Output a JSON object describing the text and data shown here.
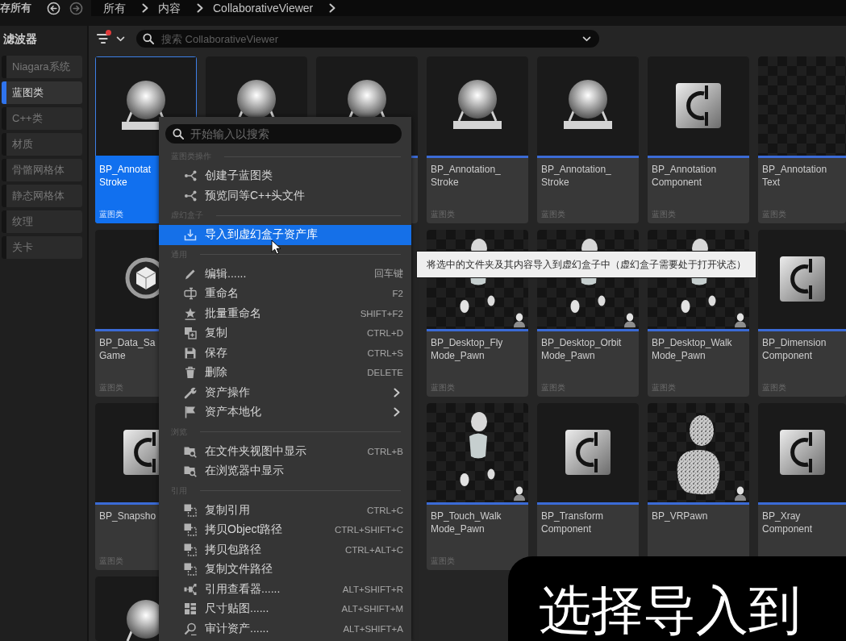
{
  "top_bar": {
    "save_all_label": "存所有",
    "breadcrumbs": [
      "所有",
      "内容",
      "CollaborativeViewer"
    ]
  },
  "filter_panel": {
    "title": "滤波器",
    "items": [
      {
        "label": "Niagara系统",
        "selected": false
      },
      {
        "label": "蓝图类",
        "selected": true
      },
      {
        "label": "C++类",
        "selected": false
      },
      {
        "label": "材质",
        "selected": false
      },
      {
        "label": "骨骼网格体",
        "selected": false
      },
      {
        "label": "静态网格体",
        "selected": false
      },
      {
        "label": "纹理",
        "selected": false
      },
      {
        "label": "关卡",
        "selected": false
      }
    ]
  },
  "toolbar": {
    "filter_active": true,
    "search": {
      "placeholder": "搜索 CollaborativeViewer"
    }
  },
  "assets": {
    "rows": [
      {
        "tiles": [
          {
            "name": [
              "BP_Annotat",
              "Stroke"
            ],
            "type": "蓝图类",
            "kind": "sphere",
            "selected": true
          },
          {
            "kind": "sphere",
            "selected": false
          },
          {
            "kind": "sphere",
            "selected": false
          },
          {
            "name": [
              "BP_Annotation_",
              "Stroke"
            ],
            "type": "蓝图类",
            "kind": "sphere",
            "selected": false
          },
          {
            "name": [
              "BP_Annotation_",
              "Stroke"
            ],
            "type": "蓝图类",
            "kind": "sphere",
            "selected": false
          },
          {
            "name": [
              "BP_Annotation",
              "Component"
            ],
            "type": "蓝图类",
            "kind": "component",
            "selected": false
          },
          {
            "name": [
              "BP_Annotation",
              "Text"
            ],
            "type": "蓝图类",
            "kind": "checker",
            "selected": false
          }
        ]
      },
      {
        "tiles": [
          {
            "name": [
              "BP_Data_Sa",
              "Game"
            ],
            "type": "蓝图类",
            "kind": "savegame",
            "selected": false
          },
          {
            "name": [
              "BP_Desktop_Fly",
              "Mode_Pawn"
            ],
            "type": "蓝图类",
            "kind": "pawn",
            "selected": false
          },
          {
            "name": [
              "BP_Desktop_Orbit",
              "Mode_Pawn"
            ],
            "type": "蓝图类",
            "kind": "pawn",
            "selected": false
          },
          {
            "name": [
              "BP_Desktop_Walk",
              "Mode_Pawn"
            ],
            "type": "蓝图类",
            "kind": "pawn",
            "selected": false
          },
          {
            "name": [
              "BP_Dimension",
              "Component"
            ],
            "type": "蓝图类",
            "kind": "component",
            "selected": false
          }
        ]
      },
      {
        "tiles": [
          {
            "name": [
              "BP_Snapsho"
            ],
            "type": "蓝图类",
            "kind": "component",
            "selected": false
          },
          {
            "name": [
              "BP_Touch_Walk",
              "Mode_Pawn"
            ],
            "type": "蓝图类",
            "kind": "pawn",
            "selected": false
          },
          {
            "name": [
              "BP_Transform",
              "Component"
            ],
            "kind": "component",
            "selected": false
          },
          {
            "name": [
              "BP_VRPawn"
            ],
            "kind": "pointcloud",
            "selected": false
          },
          {
            "name": [
              "BP_Xray",
              "Component"
            ],
            "kind": "component",
            "selected": false
          }
        ]
      },
      {
        "tiles": [
          {
            "kind": "sphere",
            "selected": false
          }
        ]
      }
    ]
  },
  "context_menu": {
    "search": {
      "placeholder": "开始输入以搜索"
    },
    "sections": [
      {
        "title": "蓝图类操作",
        "items": [
          {
            "label": "创建子蓝图类",
            "submenu": false,
            "selected": false
          },
          {
            "label": "预览同等C++头文件",
            "submenu": false,
            "selected": false
          }
        ]
      },
      {
        "title": "虚幻盒子",
        "items": [
          {
            "label": "导入到虚幻盒子资产库",
            "submenu": false,
            "selected": true
          }
        ]
      },
      {
        "title": "通用",
        "items": [
          {
            "label": "编辑......",
            "shortcut": "回车键",
            "submenu": false,
            "selected": false
          },
          {
            "label": "重命名",
            "shortcut": "F2",
            "submenu": false,
            "selected": false
          },
          {
            "label": "批量重命名",
            "shortcut": "SHIFT+F2",
            "submenu": false,
            "selected": false
          },
          {
            "label": "复制",
            "shortcut": "CTRL+D",
            "submenu": false,
            "selected": false
          },
          {
            "label": "保存",
            "shortcut": "CTRL+S",
            "submenu": false,
            "selected": false
          },
          {
            "label": "删除",
            "shortcut": "DELETE",
            "submenu": false,
            "selected": false
          },
          {
            "label": "资产操作",
            "submenu": true,
            "selected": false
          },
          {
            "label": "资产本地化",
            "submenu": true,
            "selected": false
          }
        ]
      },
      {
        "title": "浏览",
        "items": [
          {
            "label": "在文件夹视图中显示",
            "shortcut": "CTRL+B",
            "submenu": false,
            "selected": false
          },
          {
            "label": "在浏览器中显示",
            "submenu": false,
            "selected": false
          }
        ]
      },
      {
        "title": "引用",
        "items": [
          {
            "label": "复制引用",
            "shortcut": "CTRL+C",
            "submenu": false,
            "selected": false
          },
          {
            "label": "拷贝Object路径",
            "shortcut": "CTRL+SHIFT+C",
            "submenu": false,
            "selected": false
          },
          {
            "label": "拷贝包路径",
            "shortcut": "CTRL+ALT+C",
            "submenu": false,
            "selected": false
          },
          {
            "label": "复制文件路径",
            "submenu": false,
            "selected": false
          },
          {
            "label": "引用查看器......",
            "shortcut": "ALT+SHIFT+R",
            "submenu": false,
            "selected": false
          },
          {
            "label": "尺寸贴图......",
            "shortcut": "ALT+SHIFT+M",
            "submenu": false,
            "selected": false
          },
          {
            "label": "审计资产......",
            "shortcut": "ALT+SHIFT+A",
            "submenu": false,
            "selected": false
          }
        ]
      }
    ]
  },
  "tooltip": {
    "text": "将选中的文件夹及其内容导入到虚幻盒子中（虚幻盒子需要处于打开状态）"
  },
  "caption": {
    "text": "选择导入到"
  }
}
